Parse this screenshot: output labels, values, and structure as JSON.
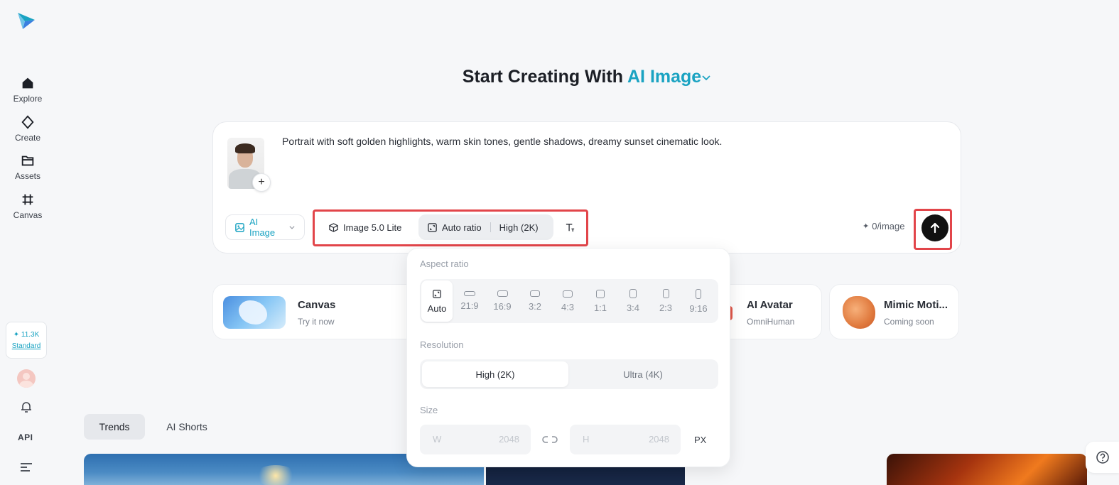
{
  "sidebar": {
    "nav": [
      {
        "label": "Explore",
        "icon": "home-icon"
      },
      {
        "label": "Create",
        "icon": "diamond-icon"
      },
      {
        "label": "Assets",
        "icon": "folder-icon"
      },
      {
        "label": "Canvas",
        "icon": "hash-icon"
      }
    ],
    "credits_amount": "11.3K",
    "credits_plan": "Standard",
    "api_label": "API"
  },
  "hero": {
    "prefix": "Start Creating With ",
    "mode": "AI Image"
  },
  "prompt": {
    "text": "Portrait with soft golden highlights, warm skin tones, gentle shadows, dreamy sunset cinematic look.",
    "mode_label": "AI Image",
    "model_label": "Image 5.0 Lite",
    "ratio_label": "Auto ratio",
    "quality_label": "High (2K)",
    "cost_label": "0/image"
  },
  "features": [
    {
      "title": "Canvas",
      "subtitle": "Try it now"
    },
    {
      "title": "AI Avatar",
      "subtitle": "OmniHuman"
    },
    {
      "title": "Mimic Moti...",
      "subtitle": "Coming soon"
    }
  ],
  "tabs": [
    "Trends",
    "AI Shorts"
  ],
  "panel": {
    "aspect_label": "Aspect ratio",
    "ratios": [
      "Auto",
      "21:9",
      "16:9",
      "3:2",
      "4:3",
      "1:1",
      "3:4",
      "2:3",
      "9:16"
    ],
    "selected_ratio": "Auto",
    "resolution_label": "Resolution",
    "resolutions": [
      "High (2K)",
      "Ultra (4K)"
    ],
    "selected_resolution": "High (2K)",
    "size_label": "Size",
    "width_key": "W",
    "width_value": "2048",
    "height_key": "H",
    "height_value": "2048",
    "unit": "PX"
  },
  "colors": {
    "accent": "#1aa3c2",
    "highlight": "#e2454a"
  }
}
